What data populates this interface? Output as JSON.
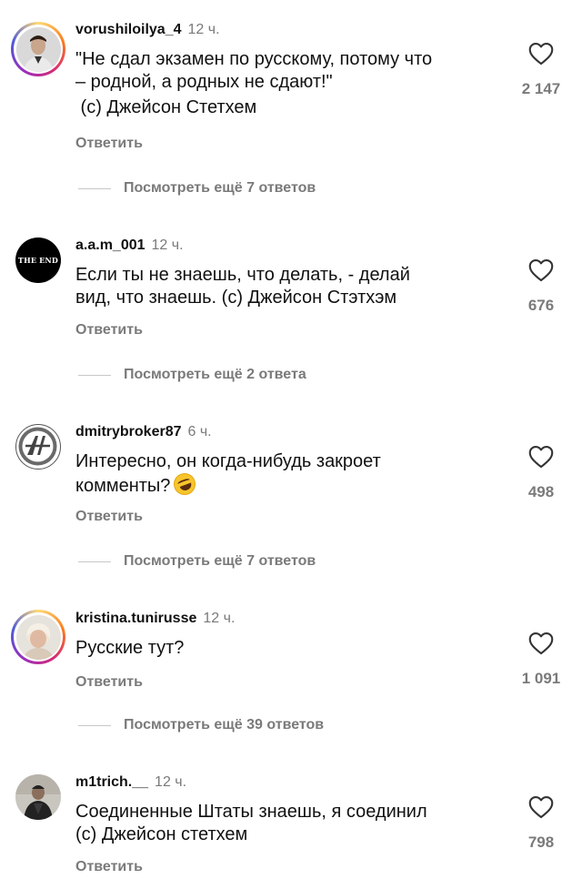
{
  "comments": [
    {
      "username": "vorushiloilya_4",
      "time": "12 ч.",
      "lines": [
        "\"Не сдал экзамен по русскому, потому что",
        "– родной, а родных не сдают!\"",
        " (c) Джейсон Стетхем"
      ],
      "reply_label": "Ответить",
      "likes": "2 147",
      "view_replies": "Посмотреть ещё 7 ответов",
      "avatar": "person-photo",
      "story_ring": true
    },
    {
      "username": "a.a.m_001",
      "time": "12 ч.",
      "lines": [
        "Если ты не знаешь, что делать, - делай",
        "вид, что знаешь. (с) Джейсон Стэтхэм"
      ],
      "reply_label": "Ответить",
      "likes": "676",
      "view_replies": "Посмотреть ещё 2 ответа",
      "avatar": "the-end-logo",
      "avatar_text": "THE END",
      "story_ring": false
    },
    {
      "username": "dmitrybroker87",
      "time": "6 ч.",
      "lines": [
        "Интересно, он когда-нибудь закроет",
        "комменты?"
      ],
      "emoji": "rolling-on-floor-laughing-emoji",
      "reply_label": "Ответить",
      "likes": "498",
      "view_replies": "Посмотреть ещё 7 ответов",
      "avatar": "monogram-logo",
      "story_ring": false
    },
    {
      "username": "kristina.tunirusse",
      "time": "12 ч.",
      "lines": [
        "Русские тут?"
      ],
      "reply_label": "Ответить",
      "likes": "1 091",
      "view_replies": "Посмотреть ещё 39 ответов",
      "avatar": "person-photo",
      "story_ring": true
    },
    {
      "username": "m1trich.__",
      "time": "12 ч.",
      "lines": [
        "Соединенные Штаты знаешь, я соединил",
        "(с) Джейсон стетхем"
      ],
      "reply_label": "Ответить",
      "likes": "798",
      "avatar": "person-photo",
      "story_ring": false
    }
  ],
  "colors": {
    "text": "#111111",
    "secondary": "#7a7a7a",
    "divider": "#c8c8c8",
    "background": "#ffffff"
  }
}
